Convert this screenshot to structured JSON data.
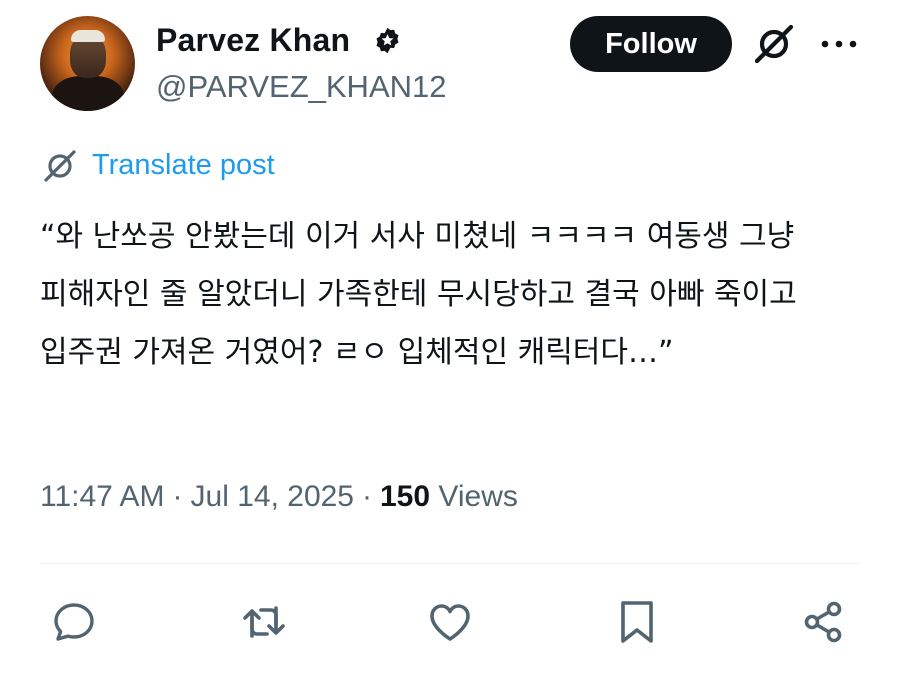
{
  "author": {
    "name": "Parvez Khan",
    "handle": "@PARVEZ_KHAN12",
    "verified_icon": "verified-badge-icon"
  },
  "header": {
    "follow_label": "Follow",
    "grok_icon": "grok-icon",
    "more_icon": "more-options-icon"
  },
  "translate": {
    "label": "Translate post",
    "icon": "translate-icon"
  },
  "post": {
    "text": "“와 난쏘공 안봤는데 이거 서사 미쳤네 ㅋㅋㅋㅋ 여동생 그냥 피해자인 줄 알았더니 가족한테 무시당하고 결국 아빠 죽이고 입주권 가져온 거였어? ㄹㅇ 입체적인 캐릭터다…”"
  },
  "meta": {
    "time": "11:47 AM",
    "date": "Jul 14, 2025",
    "separator": "·",
    "views_count": "150",
    "views_label": "Views"
  },
  "actions": [
    "reply-icon",
    "repost-icon",
    "like-icon",
    "bookmark-icon",
    "share-icon"
  ],
  "colors": {
    "text": "#0f1419",
    "secondary": "#536471",
    "link": "#1d9bf0",
    "button_bg": "#0f1419",
    "divider": "#eff3f4"
  }
}
